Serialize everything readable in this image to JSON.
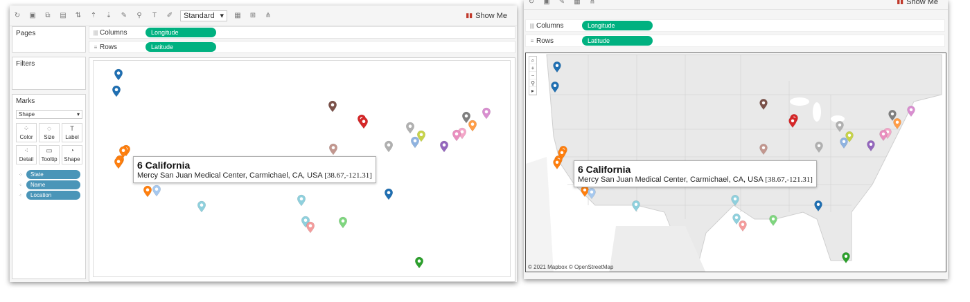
{
  "toolbar": {
    "view_size": "Standard",
    "show_me": "Show Me"
  },
  "shelves": {
    "pages_title": "Pages",
    "filters_title": "Filters",
    "columns_label": "Columns",
    "rows_label": "Rows",
    "columns_pill": "Longitude",
    "rows_pill": "Latitude"
  },
  "marks": {
    "title": "Marks",
    "type": "Shape",
    "buttons": {
      "color": "Color",
      "size": "Size",
      "label": "Label",
      "detail": "Detail",
      "tooltip": "Tooltip",
      "shape": "Shape"
    },
    "pills": [
      "State",
      "Name",
      "Location"
    ]
  },
  "tooltip": {
    "title": "6 California",
    "line": "Mercy San Juan Medical Center, Carmichael, CA, USA",
    "coords": "[38.67,-121.31]"
  },
  "map": {
    "attribution": "© 2021 Mapbox © OpenStreetMap",
    "background": "#e9e9e9",
    "water": "#ffffff"
  },
  "colors": {
    "pill_green": "#00b180",
    "pill_blue": "#4a95b8"
  },
  "markers": [
    {
      "color": "#1f6fb2"
    },
    {
      "color": "#1f6fb2"
    },
    {
      "color": "#7b5149"
    },
    {
      "color": "#d62728"
    },
    {
      "color": "#d62728"
    },
    {
      "color": "#b0b0b0"
    },
    {
      "color": "#c7d34a"
    },
    {
      "color": "#8fb3e0"
    },
    {
      "color": "#7f7f7f"
    },
    {
      "color": "#d98ed0"
    },
    {
      "color": "#ff9d47"
    },
    {
      "color": "#f4a6c8"
    },
    {
      "color": "#e98ebf"
    },
    {
      "color": "#9467bd"
    },
    {
      "color": "#b0b0b0"
    },
    {
      "color": "#c2978f"
    },
    {
      "color": "#ff7f0e"
    },
    {
      "color": "#ff7f0e"
    },
    {
      "color": "#ff7f0e"
    },
    {
      "color": "#ff7f0e"
    },
    {
      "color": "#ff7f0e"
    },
    {
      "color": "#a6c8ee"
    },
    {
      "color": "#8fd0dd"
    },
    {
      "color": "#8fd0dd"
    },
    {
      "color": "#8fd0dd"
    },
    {
      "color": "#f49c9c"
    },
    {
      "color": "#7fd67f"
    },
    {
      "color": "#1f6fb2"
    },
    {
      "color": "#2ca02c"
    }
  ]
}
